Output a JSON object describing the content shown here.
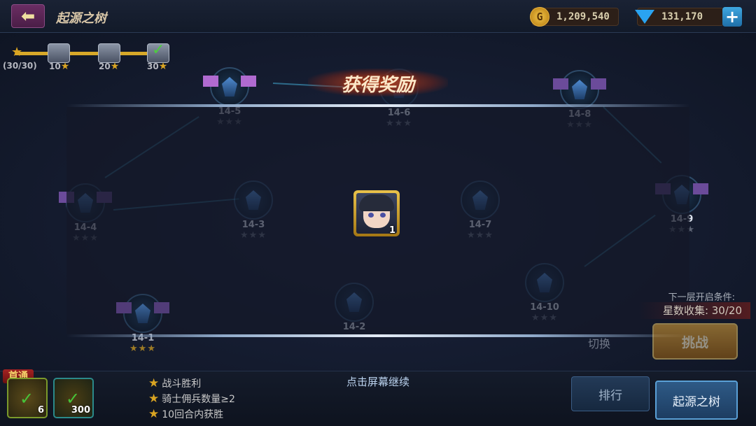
{
  "header": {
    "title": "起源之树",
    "gold": "1,209,540",
    "gems": "131,170",
    "gold_icon_letter": "G"
  },
  "star_progress": {
    "current": "(30/30)",
    "milestones": [
      "10",
      "20",
      "30"
    ]
  },
  "stages": [
    {
      "label": "14-4",
      "stars": "★★★"
    },
    {
      "label": "14-5",
      "stars": "★★★"
    },
    {
      "label": "14-9",
      "stars": "★★★"
    },
    {
      "label": "14-8",
      "stars": "★★★"
    },
    {
      "label": "14-6",
      "stars": "★★★"
    },
    {
      "label": "14-3",
      "stars": "★★★"
    },
    {
      "label": "14-7",
      "stars": "★★★"
    },
    {
      "label": "14-1",
      "stars": "★★★"
    },
    {
      "label": "14-2",
      "stars": "★★★"
    },
    {
      "label": "14-10",
      "stars": "★★★"
    }
  ],
  "reward": {
    "title": "获得奖励",
    "count": "1",
    "continue_hint": "点击屏幕继续"
  },
  "first_clear": {
    "label": "首通",
    "slots": [
      {
        "count": "6"
      },
      {
        "count": "300"
      }
    ]
  },
  "conditions": [
    "战斗胜利",
    "骑士佣兵数量≥2",
    "10回合内获胜"
  ],
  "unlock": {
    "next_label": "下一层开启条件:",
    "star_collect": "星数收集: 30/20"
  },
  "buttons": {
    "switch": "切换",
    "challenge": "挑战",
    "ranking": "排行",
    "origin_tree": "起源之树"
  },
  "colors": {
    "accent_gold": "#d9a422",
    "primary_blue": "#2e5a86"
  }
}
